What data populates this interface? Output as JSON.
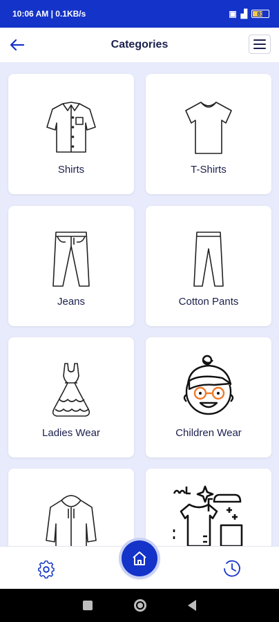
{
  "status_bar": {
    "time_text": "10:06 AM | 0.1KB/s",
    "battery_level": "83"
  },
  "app_bar": {
    "title": "Categories",
    "back_icon": "arrow-left-icon",
    "menu_icon": "hamburger-menu-icon"
  },
  "categories": [
    {
      "label": "Shirts",
      "icon": "shirt-icon"
    },
    {
      "label": "T-Shirts",
      "icon": "tshirt-icon"
    },
    {
      "label": "Jeans",
      "icon": "jeans-icon"
    },
    {
      "label": "Cotton Pants",
      "icon": "pants-icon"
    },
    {
      "label": "Ladies Wear",
      "icon": "dress-icon"
    },
    {
      "label": "Children Wear",
      "icon": "child-face-icon"
    },
    {
      "label": "",
      "icon": "hoodie-icon"
    },
    {
      "label": "",
      "icon": "laundry-icon"
    }
  ],
  "bottom_bar": {
    "left_icon": "gear-icon",
    "center_icon": "home-icon",
    "right_icon": "clock-icon"
  },
  "colors": {
    "primary": "#1433c8",
    "background": "#e8ebfb",
    "text": "#1a1f4b",
    "accent_orange": "#f07a2b"
  }
}
